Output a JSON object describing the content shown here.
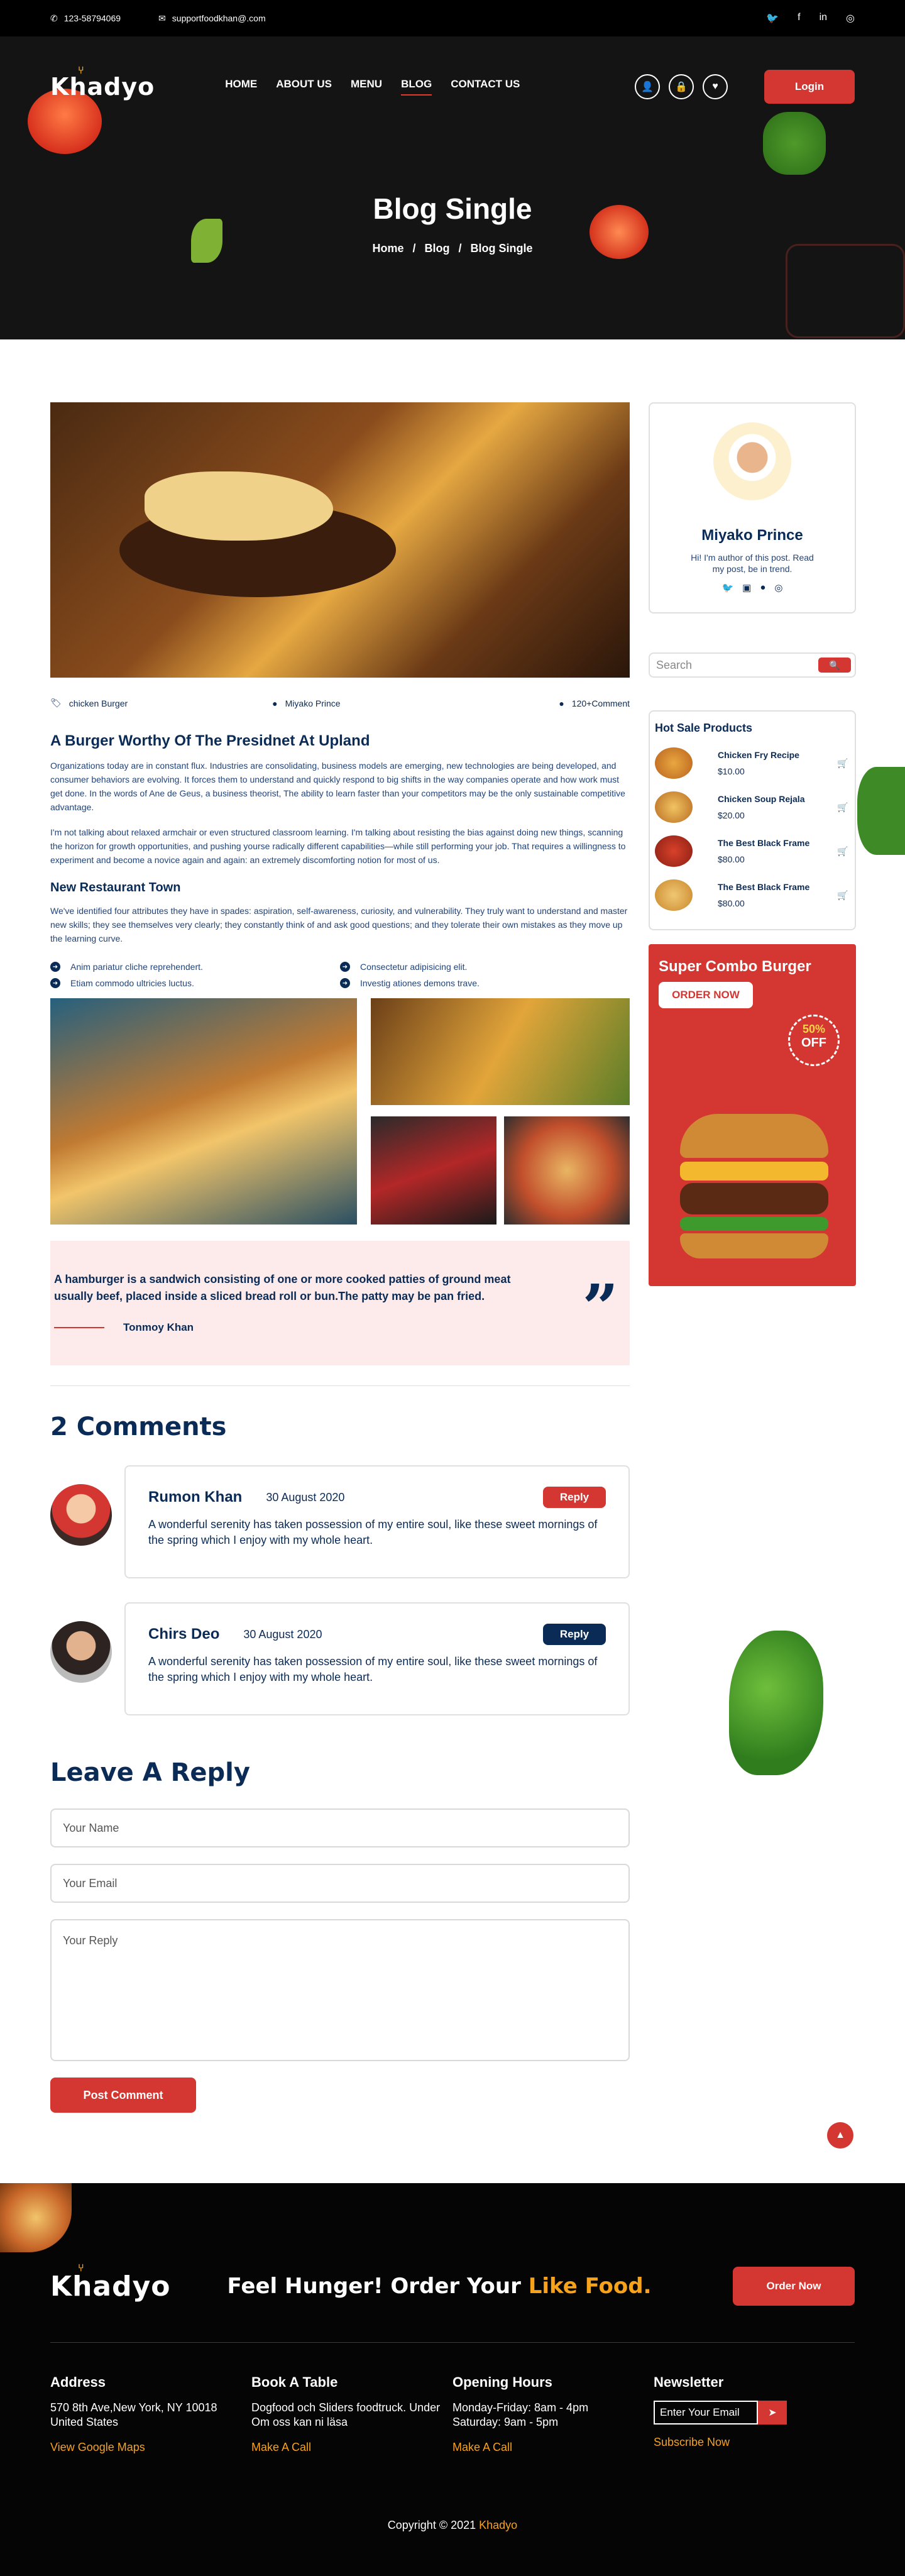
{
  "topbar": {
    "phone": "123-58794069",
    "email": "supportfoodkhan@.com"
  },
  "brand": {
    "name": "Khadyo"
  },
  "nav": [
    {
      "label": "Home",
      "active": false
    },
    {
      "label": "About us",
      "active": false
    },
    {
      "label": "Menu",
      "active": false
    },
    {
      "label": "Blog",
      "active": true
    },
    {
      "label": "Contact Us",
      "active": false
    }
  ],
  "login_label": "Login",
  "hero": {
    "title": "Blog Single",
    "crumbs": [
      "Home",
      "Blog",
      "Blog Single"
    ]
  },
  "post": {
    "category": "chicken Burger",
    "author": "Miyako Prince",
    "comments": "120+Comment",
    "title": "A Burger Worthy Of The Presidnet At Upland",
    "para1": "Organizations today are in constant flux. Industries are consolidating, business models are emerging, new technologies are being developed, and consumer behaviors are evolving. It forces them to understand and quickly respond to big shifts in the way companies operate and how work must get done. In the words of Ane de Geus, a business theorist, The ability to learn faster than your competitors may be the only sustainable competitive advantage.",
    "para2": "I'm not talking about relaxed armchair or even structured classroom learning. I'm talking about resisting the bias against doing new things, scanning the horizon for growth opportunities, and pushing yourse radically different capabilities—while still performing your job. That requires a willingness to experiment and become a novice again and again: an extremely discomforting notion for most of us.",
    "sub_title": "New Restaurant Town",
    "para3": "We've identified four attributes they have in spades: aspiration, self-awareness, curiosity, and vulnerability. They truly want to understand and master new skills; they see themselves very clearly; they constantly think of and ask good questions; and they tolerate their own mistakes as they move up the learning curve.",
    "bullets": [
      "Anim pariatur cliche reprehendert.",
      "Consectetur adipisicing elit.",
      "Etiam commodo ultricies luctus.",
      "Investig ationes demons trave."
    ],
    "quote": "A hamburger is a sandwich consisting of one or more cooked patties of ground meat usually beef, placed inside a sliced bread roll or bun.The patty may be pan fried.",
    "quote_author": "Tonmoy Khan"
  },
  "comments_title": "2 Comments",
  "comments": [
    {
      "name": "Rumon Khan",
      "date": "30 August 2020",
      "reply": "Reply",
      "text": "A wonderful serenity has taken possession of my entire soul, like these sweet mornings of the spring which I enjoy with my whole heart."
    },
    {
      "name": "Chirs Deo",
      "date": "30 August 2020",
      "reply": "Reply",
      "text": "A wonderful serenity has taken possession of my entire soul, like these sweet mornings of the spring which I enjoy with my whole heart."
    }
  ],
  "reply_form": {
    "title": "Leave A Reply",
    "name": "Your Name",
    "email": "Your Email",
    "message": "Your Reply",
    "submit": "Post Comment"
  },
  "sidebar": {
    "author_name": "Miyako Prince",
    "author_bio": "Hi! I'm author of this post. Read my post, be in trend.",
    "search_placeholder": "Search",
    "hot_title": "Hot Sale Products",
    "products": [
      {
        "name": "Chicken Fry Recipe",
        "price": "$10.00"
      },
      {
        "name": "Chicken Soup Rejala",
        "price": "$20.00"
      },
      {
        "name": "The Best Black Frame",
        "price": "$80.00"
      },
      {
        "name": "The Best Black Frame",
        "price": "$80.00"
      }
    ],
    "promo_title": "Super Combo Burger",
    "promo_button": "ORDER NOW",
    "promo_badge_top": "50%",
    "promo_badge_bottom": "OFF"
  },
  "footer": {
    "slogan": "Feel Hunger! Order Your",
    "slogan_highlight": "Like Food.",
    "order_button": "Order Now",
    "address_title": "Address",
    "address_text": "570 8th Ave,New York, NY 10018 United States",
    "address_link": "View Google Maps",
    "table_title": "Book A Table",
    "table_text": "Dogfood och Sliders foodtruck. Under Om oss kan ni läsa",
    "table_link": "Make A Call",
    "hours_title": "Opening Hours",
    "hours_text1": "Monday-Friday: 8am - 4pm",
    "hours_text2": "Saturday: 9am - 5pm",
    "hours_link": "Make A Call",
    "newsletter_title": "Newsletter",
    "newsletter_placeholder": "Enter Your Email",
    "newsletter_link": "Subscribe Now",
    "copyright": "Copyright © 2021",
    "copyright_brand": "Khadyo"
  }
}
